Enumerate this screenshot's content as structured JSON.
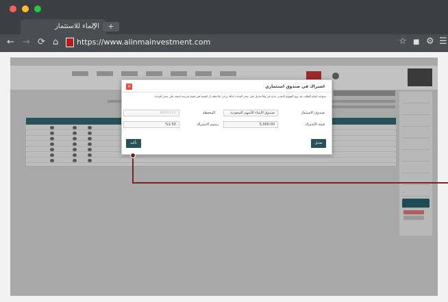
{
  "browser": {
    "tab_title": "الإنماء للاستثمار",
    "tab_close": "×",
    "new_tab": "+",
    "url": "https://www.alinmainvestment.com",
    "back": "←",
    "forward": "→",
    "reload": "⟳",
    "home": "⌂",
    "star": "☆",
    "bookmark": "■",
    "settings": "⚙",
    "menu": "☰"
  },
  "modal": {
    "title": "اشتراك في صندوق استثماري",
    "close": "×",
    "warning": "سيؤخذ اتمام الطلب بعد يوم التقويم التقدير جديد في وقاً تعديل على سعر الوحدة لذلك يرجى ملاحظة أن القيمة هي قيمة تقريبية اعتمد على سعر الوحدة",
    "fund_label": "صندوق الاستثمار",
    "fund_value": "صندوق الإنماء للأسهم السعودية",
    "portfolio_label": "المحفظة",
    "portfolio_value": "XXXXXXX",
    "amount_label": "قيمة الاشتراك",
    "amount_value": "5,000.00",
    "fee_label": "رسوم الاشتراك",
    "fee_value": "%1.50",
    "edit_button": "تعديل",
    "confirm_button": "تأكيد"
  },
  "colors": {
    "accent": "#27525a",
    "close_red": "#e74c3c",
    "pointer": "#6e2626"
  }
}
